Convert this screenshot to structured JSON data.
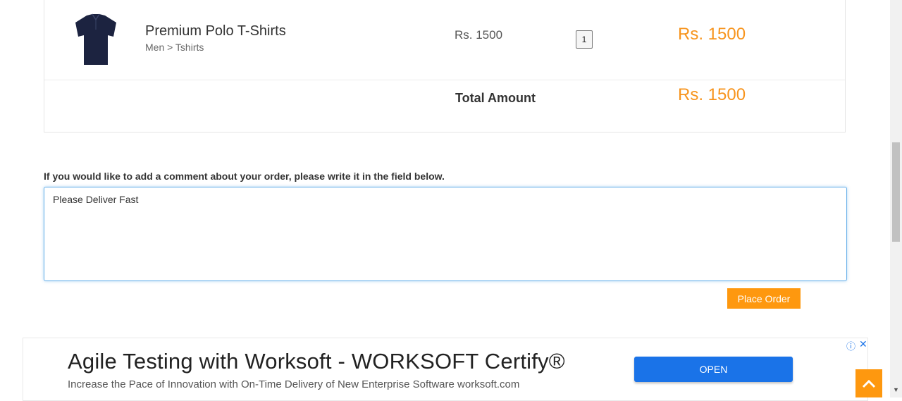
{
  "cart": {
    "item": {
      "name": "Premium Polo T-Shirts",
      "category": "Men > Tshirts",
      "price": "Rs. 1500",
      "quantity": "1",
      "total": "Rs. 1500",
      "image_icon": "navy-polo-tshirt-image"
    },
    "total_label": "Total Amount",
    "total_value": "Rs. 1500"
  },
  "comment": {
    "label": "If you would like to add a comment about your order, please write it in the field below.",
    "value": "Please Deliver Fast"
  },
  "place_order_label": "Place Order",
  "ad": {
    "title": "Agile Testing with Worksoft - WORKSOFT Certify®",
    "description": "Increase the Pace of Innovation with On-Time Delivery of New Enterprise Software worksoft.com",
    "open_label": "OPEN",
    "info_icon": "ⓘ",
    "close_icon": "✕"
  },
  "colors": {
    "accent": "#fe980f",
    "price": "#f7941d",
    "ad_button": "#1a73e8"
  }
}
